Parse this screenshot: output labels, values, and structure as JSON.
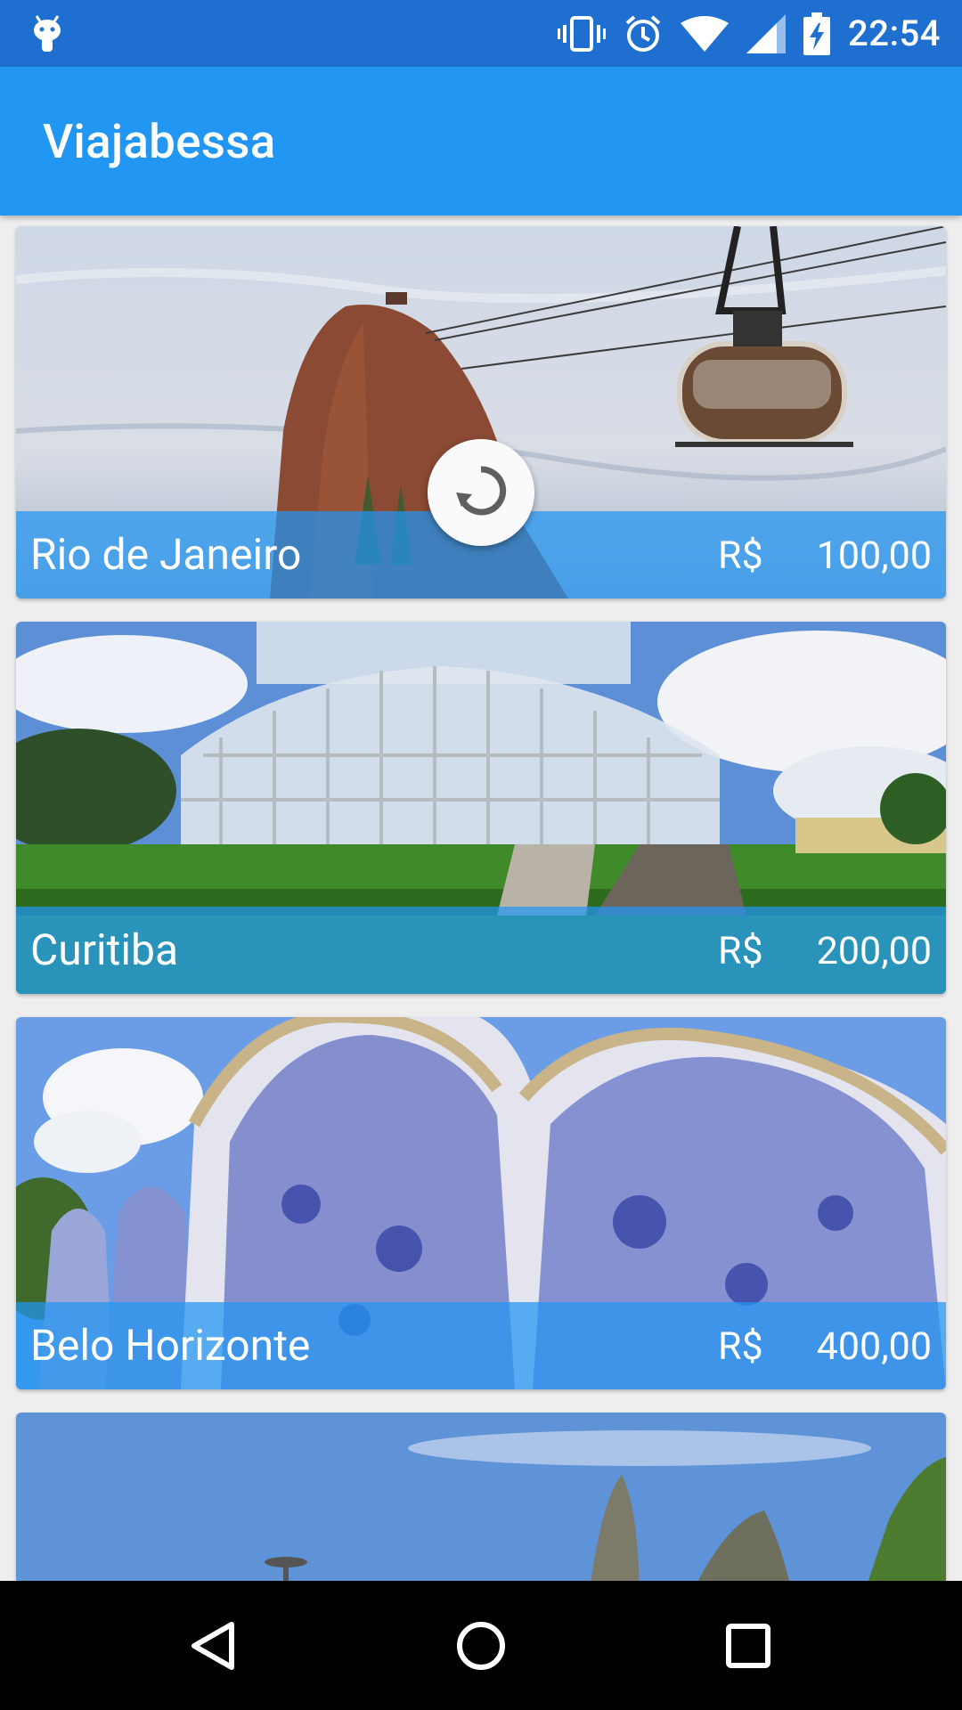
{
  "status_bar": {
    "time": "22:54",
    "icons": [
      "android-debug-icon",
      "vibrate-icon",
      "alarm-icon",
      "wifi-icon",
      "signal-icon",
      "battery-charging-icon"
    ]
  },
  "app_bar": {
    "title": "Viajabessa"
  },
  "refresh": {
    "icon": "refresh-icon"
  },
  "packages": [
    {
      "city": "Rio de Janeiro",
      "currency": "R$",
      "price": "100,00"
    },
    {
      "city": "Curitiba",
      "currency": "R$",
      "price": "200,00"
    },
    {
      "city": "Belo Horizonte",
      "currency": "R$",
      "price": "400,00"
    },
    {
      "city": "",
      "currency": "",
      "price": ""
    }
  ],
  "nav_bar": {
    "icons": [
      "back-icon",
      "home-icon",
      "recents-icon"
    ]
  },
  "colors": {
    "primary": "#2196f3",
    "primary_dark": "#1e6fcf",
    "caption_overlay": "rgba(33,150,243,0.72)"
  }
}
